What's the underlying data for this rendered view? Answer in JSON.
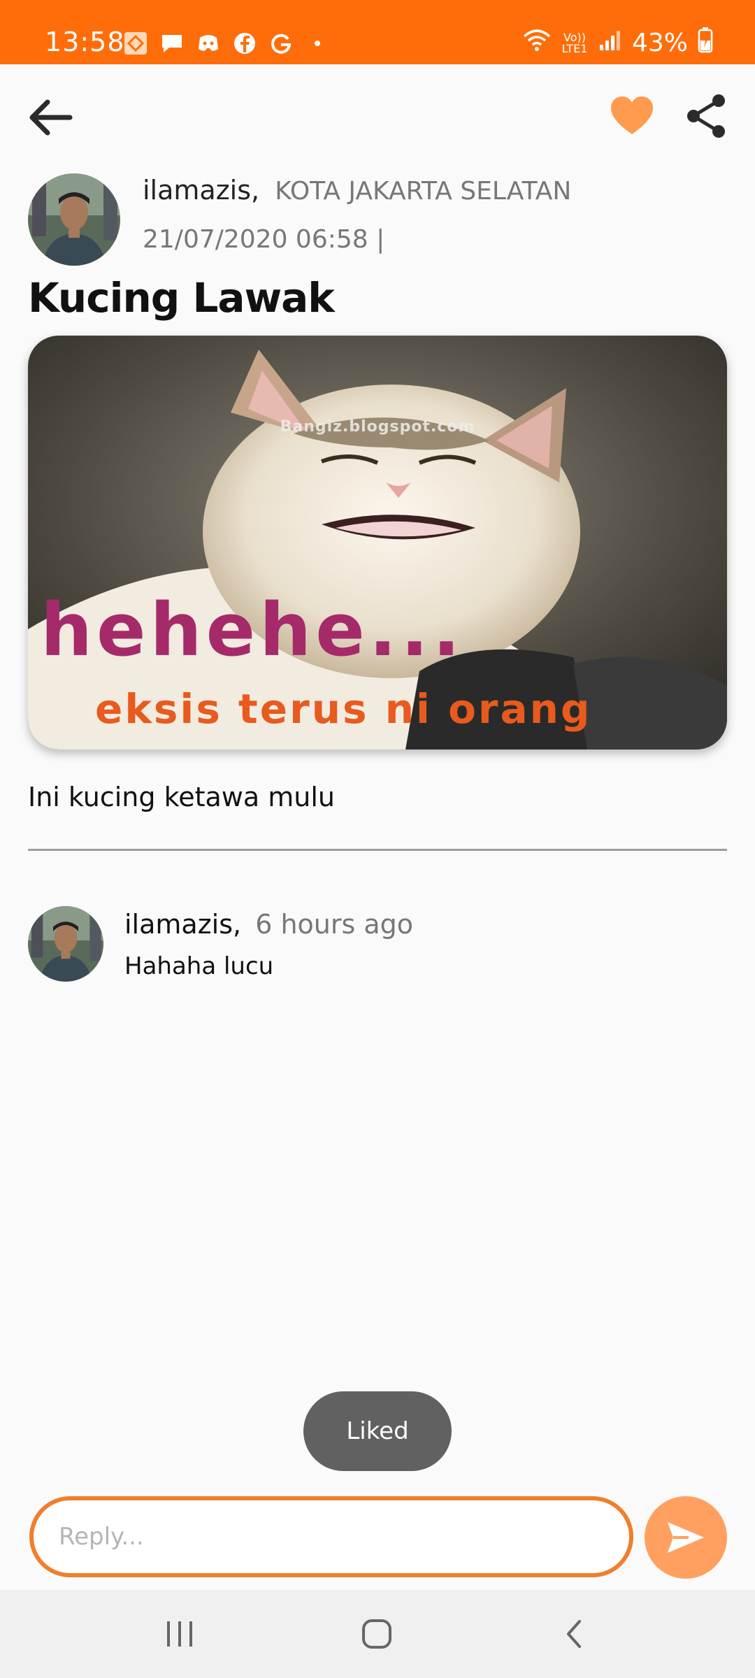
{
  "status_bar": {
    "time": "13:58",
    "battery": "43%",
    "network": "Vo)) LTE1",
    "notification_icons": [
      "maps-icon",
      "message-icon",
      "discord-icon",
      "facebook-icon",
      "google-icon"
    ],
    "background": "#ff6d0a"
  },
  "toolbar": {
    "accent": "#ff9a4f"
  },
  "post": {
    "author": "ilamazis,",
    "location": "KOTA JAKARTA SELATAN",
    "date": "21/07/2020 06:58  |",
    "title": "Kucing Lawak",
    "image_watermark": "Bangiz.blogspot.com",
    "image_caption_big": "hehehe...",
    "image_caption_small": "eksis terus ni orang",
    "body": "Ini kucing ketawa mulu"
  },
  "comments": [
    {
      "author": "ilamazis,",
      "time": "6 hours ago",
      "text": "Hahaha lucu"
    }
  ],
  "toast": {
    "text": "Liked"
  },
  "reply": {
    "placeholder": "Reply..."
  },
  "colors": {
    "accent": "#f07f2c",
    "send": "#ffa060",
    "toast": "#616161"
  }
}
